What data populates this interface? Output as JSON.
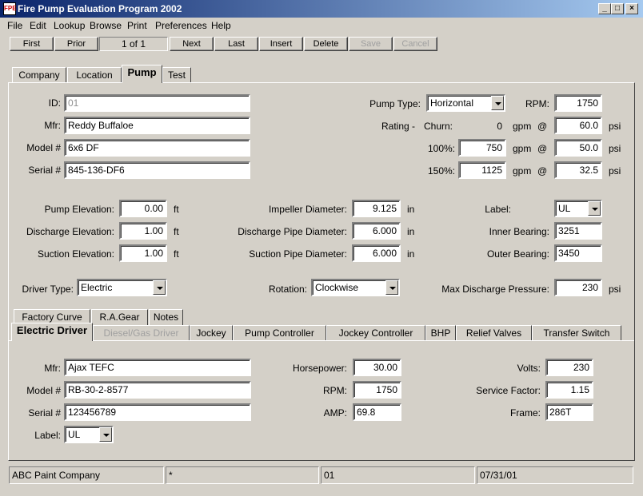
{
  "window": {
    "title": "Fire Pump Evaluation Program 2002",
    "icon_text": "FPE",
    "minimize_glyph": "_",
    "maximize_glyph": "□",
    "close_glyph": "×"
  },
  "menu": [
    "File",
    "Edit",
    "Lookup",
    "Browse",
    "Print",
    "Preferences",
    "Help"
  ],
  "toolbar": {
    "first": "First",
    "prior": "Prior",
    "counter": "1 of 1",
    "next": "Next",
    "last": "Last",
    "insert": "Insert",
    "delete": "Delete",
    "save": "Save",
    "cancel": "Cancel"
  },
  "main_tabs": [
    "Company",
    "Location",
    "Pump",
    "Test"
  ],
  "pump": {
    "id_label": "ID:",
    "id": "01",
    "mfr_label": "Mfr:",
    "mfr": "Reddy Buffaloe",
    "model_label": "Model #",
    "model": "6x6 DF",
    "serial_label": "Serial #",
    "serial": "845-136-DF6",
    "pump_type_label": "Pump Type:",
    "pump_type": "Horizontal",
    "rpm_label": "RPM:",
    "rpm": "1750",
    "rating_label": "Rating -",
    "churn_label": "Churn:",
    "churn_gpm": "0",
    "churn_psi": "60.0",
    "r100_label": "100%:",
    "r100_gpm": "750",
    "r100_psi": "50.0",
    "r150_label": "150%:",
    "r150_gpm": "1125",
    "r150_psi": "32.5",
    "gpm_unit": "gpm",
    "at": "@",
    "psi_unit": "psi",
    "pump_elev_label": "Pump Elevation:",
    "pump_elev": "0.00",
    "disch_elev_label": "Discharge Elevation:",
    "disch_elev": "1.00",
    "suct_elev_label": "Suction Elevation:",
    "suct_elev": "1.00",
    "ft_unit": "ft",
    "impeller_label": "Impeller Diameter:",
    "impeller": "9.125",
    "disch_pipe_label": "Discharge Pipe Diameter:",
    "disch_pipe": "6.000",
    "suct_pipe_label": "Suction Pipe Diameter:",
    "suct_pipe": "6.000",
    "in_unit": "in",
    "label_label": "Label:",
    "label": "UL",
    "inner_bearing_label": "Inner Bearing:",
    "inner_bearing": "3251",
    "outer_bearing_label": "Outer Bearing:",
    "outer_bearing": "3450",
    "driver_type_label": "Driver Type:",
    "driver_type": "Electric",
    "rotation_label": "Rotation:",
    "rotation": "Clockwise",
    "max_disch_label": "Max Discharge Pressure:",
    "max_disch": "230"
  },
  "sub_tabs_row1": [
    "Factory Curve",
    "R.A.Gear",
    "Notes"
  ],
  "sub_tabs_row2": [
    "Electric Driver",
    "Diesel/Gas Driver",
    "Jockey",
    "Pump Controller",
    "Jockey Controller",
    "BHP",
    "Relief Valves",
    "Transfer Switch"
  ],
  "driver": {
    "mfr_label": "Mfr:",
    "mfr": "Ajax TEFC",
    "model_label": "Model #",
    "model": "RB-30-2-8577",
    "serial_label": "Serial #",
    "serial": "123456789",
    "label_label": "Label:",
    "label": "UL",
    "hp_label": "Horsepower:",
    "hp": "30.00",
    "rpm_label": "RPM:",
    "rpm": "1750",
    "amp_label": "AMP:",
    "amp": "69.8",
    "volts_label": "Volts:",
    "volts": "230",
    "sf_label": "Service Factor:",
    "sf": "1.15",
    "frame_label": "Frame:",
    "frame": "286T"
  },
  "status": {
    "company": "ABC Paint Company",
    "flag": "*",
    "id": "01",
    "date": "07/31/01"
  }
}
